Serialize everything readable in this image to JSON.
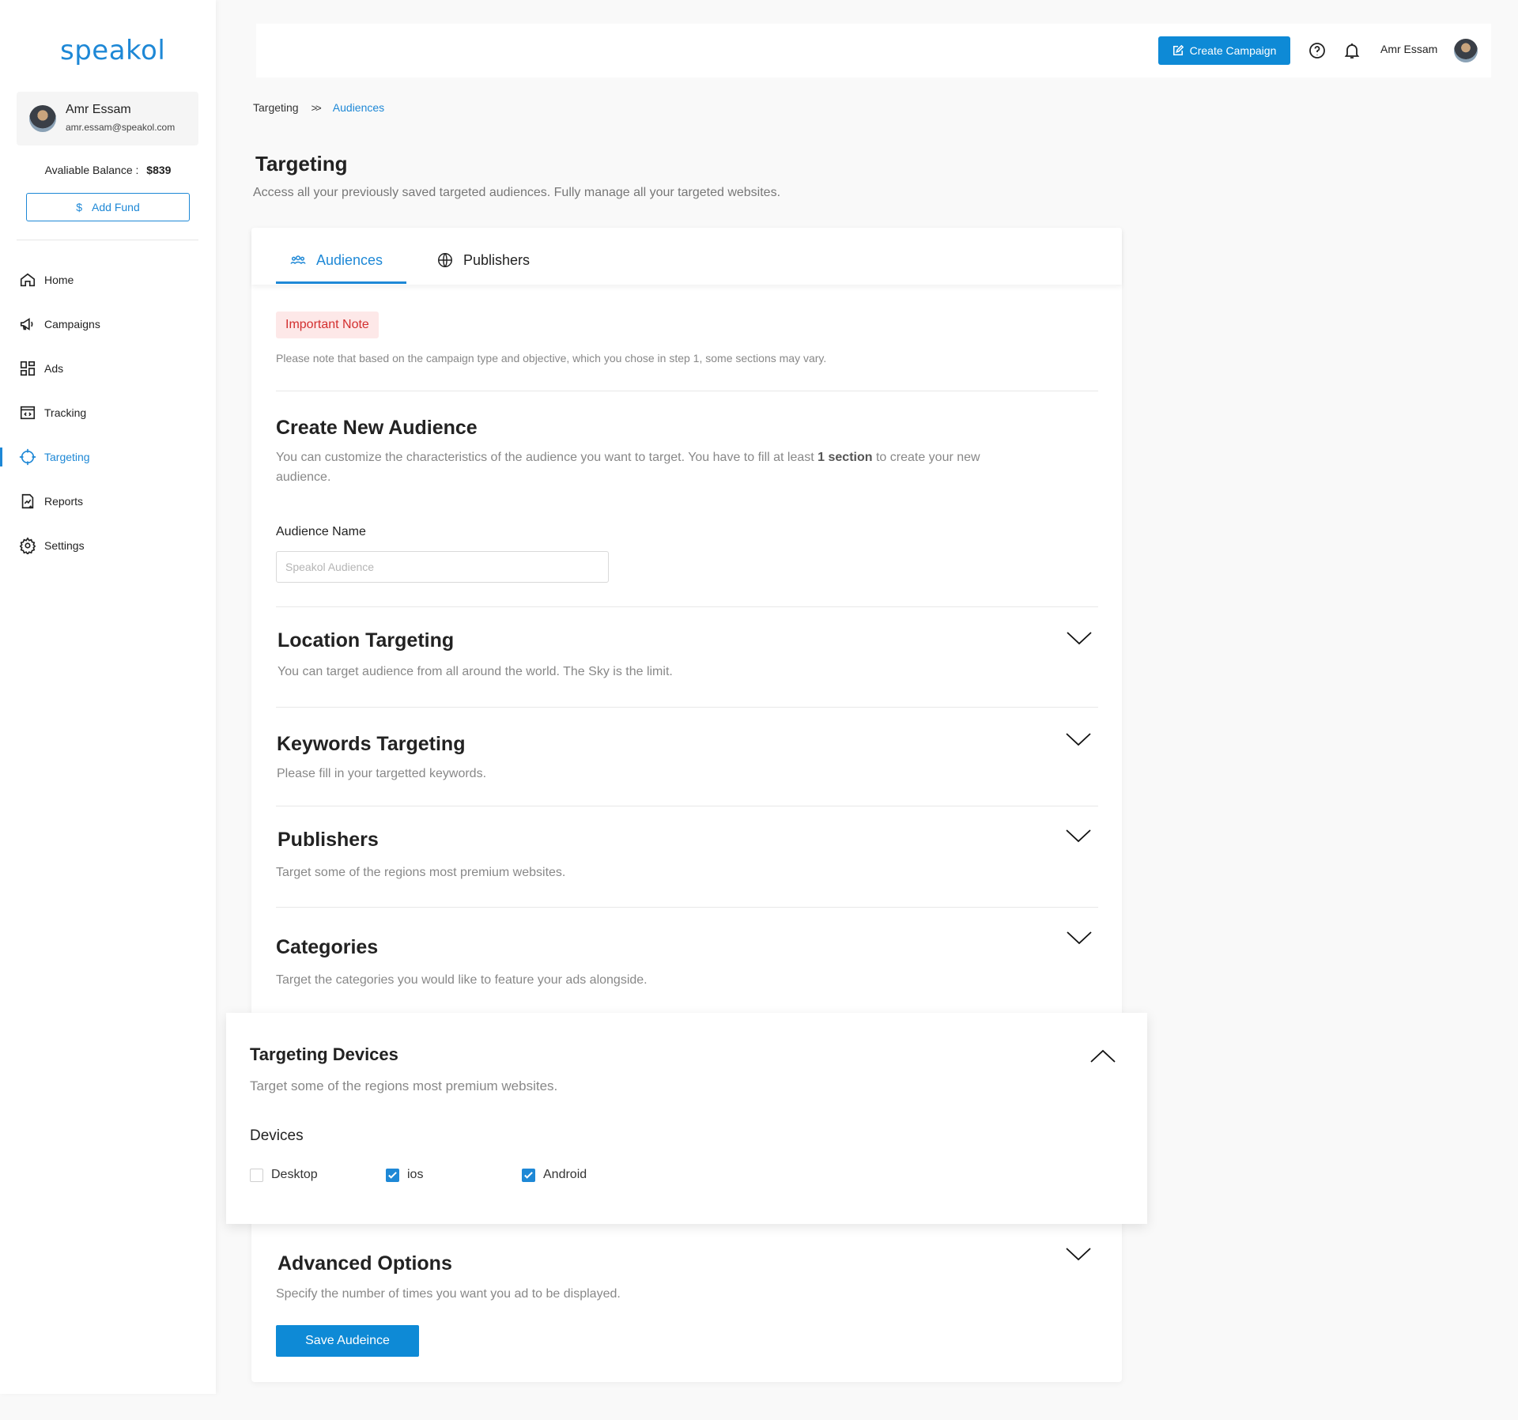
{
  "app": {
    "logo": "speakol",
    "brand_color": "#1e88d6"
  },
  "sidebar": {
    "user": {
      "name": "Amr Essam",
      "email": "amr.essam@speakol.com"
    },
    "balance_label": "Avaliable Balance :",
    "balance_value": "$839",
    "add_fund_icon": "$",
    "add_fund_label": "Add Fund",
    "items": [
      {
        "label": "Home",
        "icon": "home-icon"
      },
      {
        "label": "Campaigns",
        "icon": "megaphone-icon"
      },
      {
        "label": "Ads",
        "icon": "grid-icon"
      },
      {
        "label": "Tracking",
        "icon": "code-window-icon"
      },
      {
        "label": "Targeting",
        "icon": "crosshair-icon",
        "active": true
      },
      {
        "label": "Reports",
        "icon": "report-icon"
      },
      {
        "label": "Settings",
        "icon": "gear-icon"
      }
    ]
  },
  "topbar": {
    "create_campaign_label": "Create Campaign",
    "user_name": "Amr Essam",
    "icons": [
      "help-icon",
      "bell-icon"
    ]
  },
  "breadcrumb": {
    "items": [
      "Targeting",
      "Audiences"
    ],
    "separator": ">>"
  },
  "header": {
    "title": "Targeting",
    "description": "Access all your previously saved targeted audiences. Fully manage all your targeted websites."
  },
  "tabs": [
    {
      "label": "Audiences",
      "icon": "people-icon",
      "active": true
    },
    {
      "label": "Publishers",
      "icon": "www-globe-icon"
    }
  ],
  "note": {
    "badge": "Important Note",
    "text": "Please note that based on the campaign type and objective, which you chose in step 1, some sections may vary."
  },
  "create_audience": {
    "title": "Create New Audience",
    "desc_before": "You can customize the characteristics of the audience you want to target. You have to fill at least ",
    "desc_bold": "1 section",
    "desc_after": " to create your new audience.",
    "field_label": "Audience Name",
    "field_placeholder": "Speakol Audience"
  },
  "sections": {
    "location": {
      "title": "Location Targeting",
      "desc": "You can target audience from all around the world. The Sky is the limit."
    },
    "keywords": {
      "title": "Keywords Targeting",
      "desc": "Please fill in your targetted keywords."
    },
    "publishers": {
      "title": "Publishers",
      "desc": "Target some of the regions most premium websites."
    },
    "categories": {
      "title": "Categories",
      "desc": "Target the categories you would like to feature your ads alongside."
    },
    "devices": {
      "title": "Targeting Devices",
      "desc": "Target some of the regions most premium websites.",
      "label": "Devices",
      "options": [
        {
          "label": "Desktop",
          "checked": false
        },
        {
          "label": "ios",
          "checked": true
        },
        {
          "label": "Android",
          "checked": true
        }
      ]
    },
    "advanced": {
      "title": "Advanced Options",
      "desc": "Specify the number of times you want you ad to be displayed."
    }
  },
  "save_label": "Save Audeince"
}
